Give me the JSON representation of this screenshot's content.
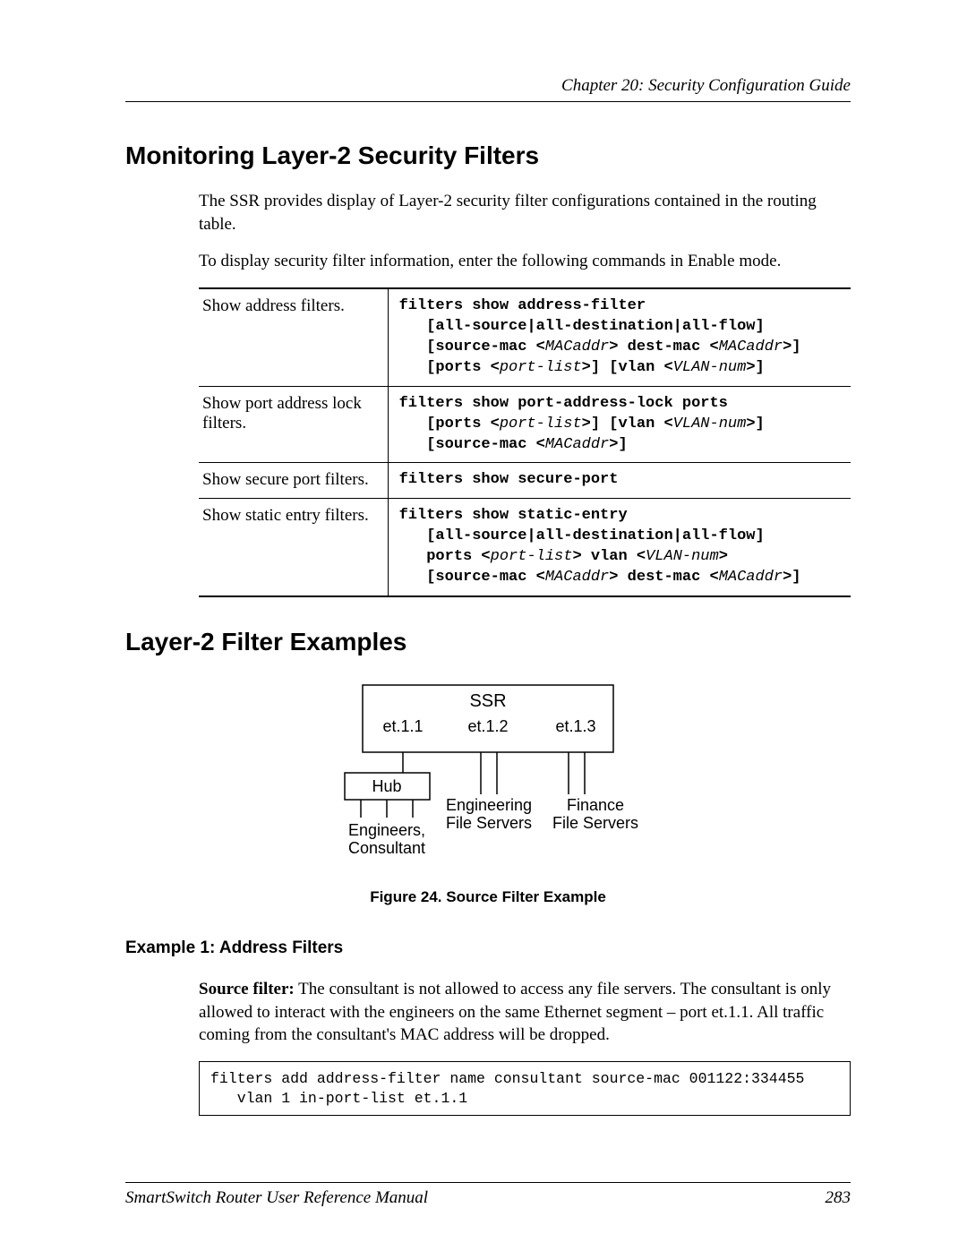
{
  "header": {
    "chapter": "Chapter 20: Security Configuration Guide"
  },
  "section1": {
    "title": "Monitoring Layer-2 Security Filters",
    "para1": "The SSR provides display of Layer-2 security filter configurations contained in the routing table.",
    "para2": "To display security filter information, enter the following commands in Enable mode."
  },
  "table": {
    "rows": [
      {
        "desc": "Show address filters.",
        "cmd_html": "filters show address-filter\n   [all-source|all-destination|all-flow]\n   [source-mac <<i>MACaddr</i>> dest-mac <<i>MACaddr</i>>]\n   [ports <<i>port-list</i>>] [vlan <<i>VLAN-num</i>>]"
      },
      {
        "desc": "Show port address lock filters.",
        "cmd_html": "filters show port-address-lock ports\n   [ports <<i>port-list</i>>] [vlan <<i>VLAN-num</i>>]\n   [source-mac <<i>MACaddr</i>>]"
      },
      {
        "desc": "Show secure port filters.",
        "cmd_html": "filters show secure-port"
      },
      {
        "desc": "Show static entry filters.",
        "cmd_html": "filters show static-entry\n   [all-source|all-destination|all-flow]\n   ports <<i>port-list</i>> vlan <<i>VLAN-num</i>>\n   [source-mac <<i>MACaddr</i>> dest-mac <<i>MACaddr</i>>]"
      }
    ]
  },
  "section2": {
    "title": "Layer-2 Filter Examples"
  },
  "diagram": {
    "ssr": "SSR",
    "ports": [
      "et.1.1",
      "et.1.2",
      "et.1.3"
    ],
    "hub": "Hub",
    "engcons1": "Engineers,",
    "engcons2": "Consultant",
    "eng1": "Engineering",
    "eng2": "File Servers",
    "fin1": "Finance",
    "fin2": "File Servers"
  },
  "figure_caption": "Figure 24.  Source Filter Example",
  "example1": {
    "title": "Example 1: Address Filters",
    "lead": "Source filter:",
    "body": " The consultant is not allowed to access any file servers. The consultant is only allowed to interact with the engineers on the same Ethernet segment – port et.1.1. All traffic coming from the consultant's MAC address will be dropped.",
    "code": "filters add address-filter name consultant source-mac 001122:334455\n   vlan 1 in-port-list et.1.1"
  },
  "footer": {
    "manual": "SmartSwitch Router User Reference Manual",
    "page": "283"
  }
}
